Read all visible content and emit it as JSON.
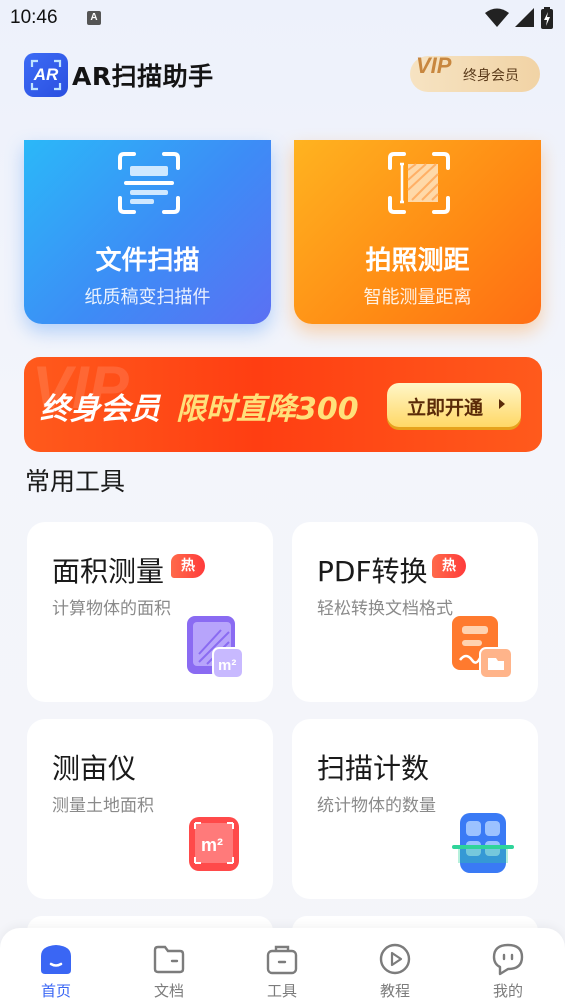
{
  "status_bar": {
    "time": "10:46",
    "notif_badge": "A"
  },
  "header": {
    "logo_text": "AR",
    "title": "AR扫描助手",
    "vip_mark": "VIP",
    "vip_label": "终身会员"
  },
  "hero_cards": [
    {
      "title": "文件扫描",
      "subtitle": "纸质稿变扫描件",
      "icon": "scan-document-icon",
      "color": "#3d8cf6"
    },
    {
      "title": "拍照测距",
      "subtitle": "智能测量距离",
      "icon": "ruler-scan-icon",
      "color": "#ff8a14"
    }
  ],
  "promo": {
    "bg_text": "VIP",
    "text_main": "终身会员",
    "text_highlight": "限时直降300",
    "button_label": "立即开通"
  },
  "tools_section": {
    "title": "常用工具",
    "items": [
      {
        "title": "面积测量",
        "subtitle": "计算物体的面积",
        "hot": "热",
        "icon": "area-measure-icon"
      },
      {
        "title": "PDF转换",
        "subtitle": "轻松转换文档格式",
        "hot": "热",
        "icon": "pdf-convert-icon"
      },
      {
        "title": "测亩仪",
        "subtitle": "测量土地面积",
        "hot": "",
        "icon": "land-measure-icon"
      },
      {
        "title": "扫描计数",
        "subtitle": "统计物体的数量",
        "hot": "",
        "icon": "scan-count-icon"
      }
    ]
  },
  "bottom_nav": [
    {
      "label": "首页",
      "icon": "home-icon",
      "active": true
    },
    {
      "label": "文档",
      "icon": "folder-icon",
      "active": false
    },
    {
      "label": "工具",
      "icon": "toolbox-icon",
      "active": false
    },
    {
      "label": "教程",
      "icon": "play-icon",
      "active": false
    },
    {
      "label": "我的",
      "icon": "profile-icon",
      "active": false
    }
  ],
  "colors": {
    "accent": "#3a66f4",
    "hot_badge": "#ff3b3b",
    "promo": "#ff3e12"
  }
}
